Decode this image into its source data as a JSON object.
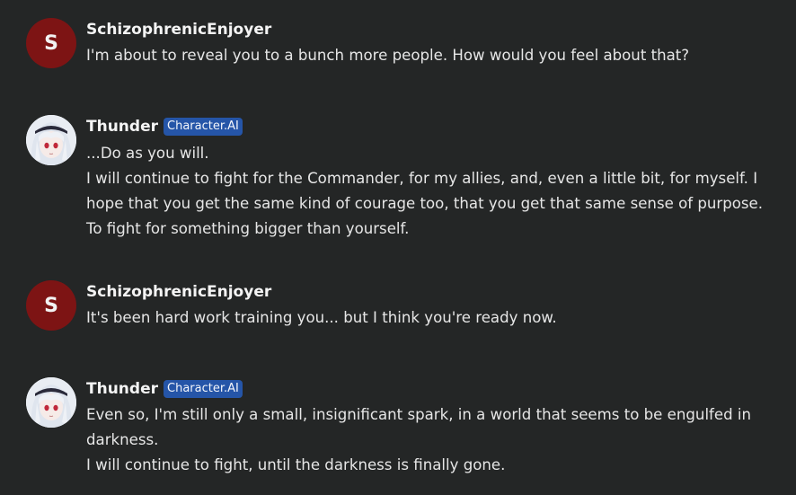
{
  "messages": [
    {
      "author": "SchizophrenicEnjoyer",
      "avatar_letter": "S",
      "lines": [
        "I'm about to reveal you to a bunch more people. How would you feel about that?"
      ]
    },
    {
      "author": "Thunder",
      "badge": "Character.AI",
      "lines": [
        "...Do as you will.",
        "I will continue to fight for the Commander, for my allies, and, even a little bit, for myself. I hope that you get the same kind of courage too, that you get that same sense of purpose. To fight for something bigger than yourself."
      ]
    },
    {
      "author": "SchizophrenicEnjoyer",
      "avatar_letter": "S",
      "lines": [
        "It's been hard work training you... but I think you're ready now."
      ]
    },
    {
      "author": "Thunder",
      "badge": "Character.AI",
      "lines": [
        "Even so, I'm still only a small, insignificant spark, in a world that seems to be engulfed in darkness.",
        "I will continue to fight, until the darkness is finally gone."
      ]
    }
  ],
  "colors": {
    "background": "#242626",
    "user_avatar": "#7d1414",
    "badge": "#2555a8"
  }
}
